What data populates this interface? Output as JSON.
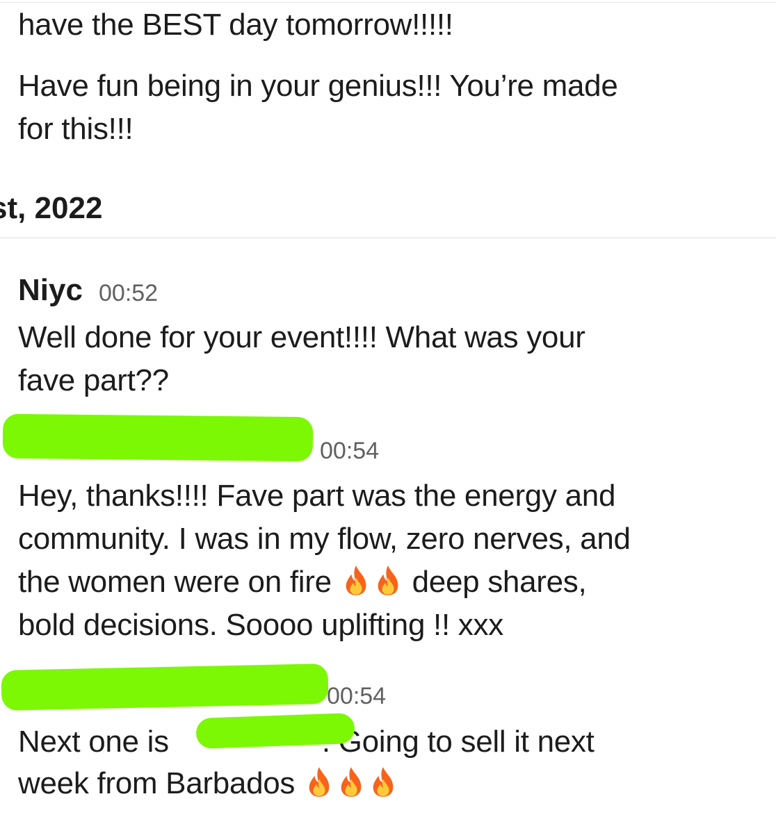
{
  "messages_top": {
    "line1": "have the BEST day tomorrow!!!!!",
    "line2a": "Have fun being in your genius!!! You’re made",
    "line2b": "for this!!!"
  },
  "date_divider": {
    "label": "st, 2022"
  },
  "message_niyc": {
    "sender": "Niyc",
    "time": "00:52",
    "line1": "Well done for your event!!!! What was your",
    "line2": "fave part??"
  },
  "message_reply_1": {
    "time": "00:54",
    "line1": "Hey, thanks!!!! Fave part was the energy and",
    "line2": "community. I was in my flow, zero nerves, and",
    "line3a": "the women were on fire",
    "line3b": "deep shares,",
    "line4": "bold decisions. Soooo uplifting !! xxx"
  },
  "message_reply_2": {
    "time": "00:54",
    "line1a": "Next one is",
    "line1b": ". Going to sell it next",
    "line2": "week from Barbados"
  },
  "icons": {
    "emoji": "fire-emoji-icon"
  },
  "colors": {
    "redaction": "#7cf805",
    "timestamp": "#616061",
    "text": "#1d1c1d"
  }
}
